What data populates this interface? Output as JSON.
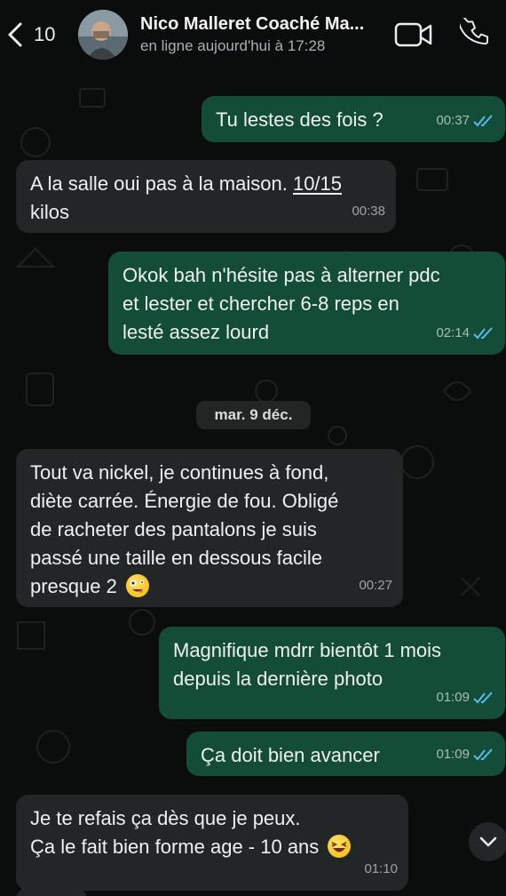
{
  "header": {
    "back_count": "10",
    "contact_name": "Nico Malleret Coaché Ma...",
    "status": "en ligne aujourd'hui à 17:28",
    "back_icon": "chevron-left-icon",
    "video_icon": "video-camera-icon",
    "call_icon": "phone-icon"
  },
  "messages": [
    {
      "id": "m1",
      "dir": "out",
      "text": "Tu lestes des fois ?",
      "time": "00:37",
      "read": true
    },
    {
      "id": "m2",
      "dir": "in",
      "text_before": "A la salle oui pas à la maison. ",
      "link": "10/15",
      "text_after": "kilos",
      "time": "00:38"
    },
    {
      "id": "m3",
      "dir": "out",
      "lines": [
        "Okok bah n'hésite pas à alterner pdc",
        "et lester et chercher 6-8 reps en",
        "lesté assez lourd"
      ],
      "time": "02:14",
      "read": true
    },
    {
      "id": "m4",
      "dir": "in",
      "lines": [
        "Tout va nickel, je continues à fond,",
        "diète carrée. Énergie de fou. Obligé",
        "de racheter des pantalons je suis",
        "passé une taille en dessous facile",
        "presque 2"
      ],
      "emoji": "zany-face-emoji",
      "time": "00:27"
    },
    {
      "id": "m5",
      "dir": "out",
      "lines": [
        "Magnifique mdrr bientôt 1 mois",
        "depuis la dernière photo"
      ],
      "time": "01:09",
      "read": true
    },
    {
      "id": "m6",
      "dir": "out",
      "text": "Ça doit bien avancer",
      "time": "01:09",
      "read": true
    },
    {
      "id": "m7",
      "dir": "in",
      "lines": [
        "Je te refais ça dès que je peux.",
        "Ça le fait bien forme age - 10 ans"
      ],
      "emoji": "laughing-face-emoji",
      "time": "01:10"
    }
  ],
  "date_separator": "mar. 9 déc.",
  "colors": {
    "background": "#0b0d0c",
    "incoming_bubble": "#232626",
    "outgoing_bubble": "#144d37",
    "read_ticks": "#53bdeb"
  }
}
